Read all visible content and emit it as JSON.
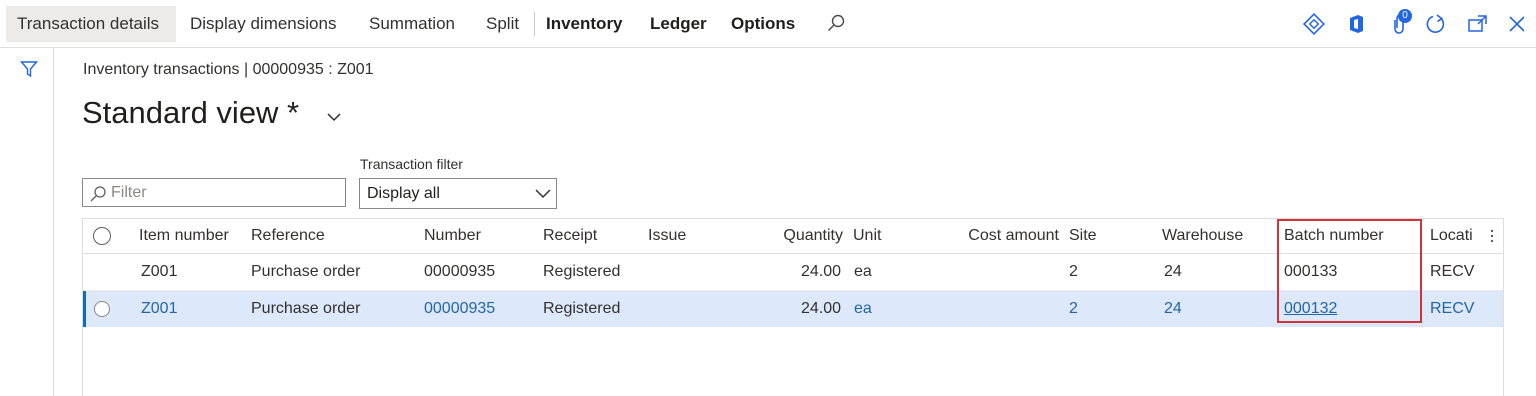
{
  "tabs": {
    "transaction_details": "Transaction details",
    "display_dimensions": "Display dimensions",
    "summation": "Summation",
    "split": "Split",
    "inventory": "Inventory",
    "ledger": "Ledger",
    "options": "Options"
  },
  "toolbar_icons": [
    "search-icon",
    "diamond-icon",
    "office-icon",
    "attachment-icon",
    "refresh-icon",
    "open-in-new-window-icon",
    "close-icon"
  ],
  "attachments_count": "0",
  "breadcrumb": "Inventory transactions  |  00000935 : Z001",
  "view": {
    "title": "Standard view *"
  },
  "filter": {
    "placeholder": "Filter",
    "value": ""
  },
  "transaction_filter": {
    "label": "Transaction filter",
    "value": "Display all"
  },
  "grid": {
    "columns": [
      "Item number",
      "Reference",
      "Number",
      "Receipt",
      "Issue",
      "Quantity",
      "Unit",
      "Cost amount",
      "Site",
      "Warehouse",
      "Batch number",
      "Locati"
    ],
    "rows": [
      {
        "item": "Z001",
        "reference": "Purchase order",
        "number": "00000935",
        "receipt": "Registered",
        "issue": "",
        "quantity": "24.00",
        "unit": "ea",
        "cost": "",
        "site": "2",
        "warehouse": "24",
        "batch": "000133",
        "location": "RECV"
      },
      {
        "item": "Z001",
        "reference": "Purchase order",
        "number": "00000935",
        "receipt": "Registered",
        "issue": "",
        "quantity": "24.00",
        "unit": "ea",
        "cost": "",
        "site": "2",
        "warehouse": "24",
        "batch": "000132",
        "location": "RECV"
      }
    ]
  },
  "colors": {
    "accent": "#0f6cbd",
    "selected_row": "#dde8fb",
    "highlight_box": "#d13438",
    "link": "#2266a3"
  }
}
